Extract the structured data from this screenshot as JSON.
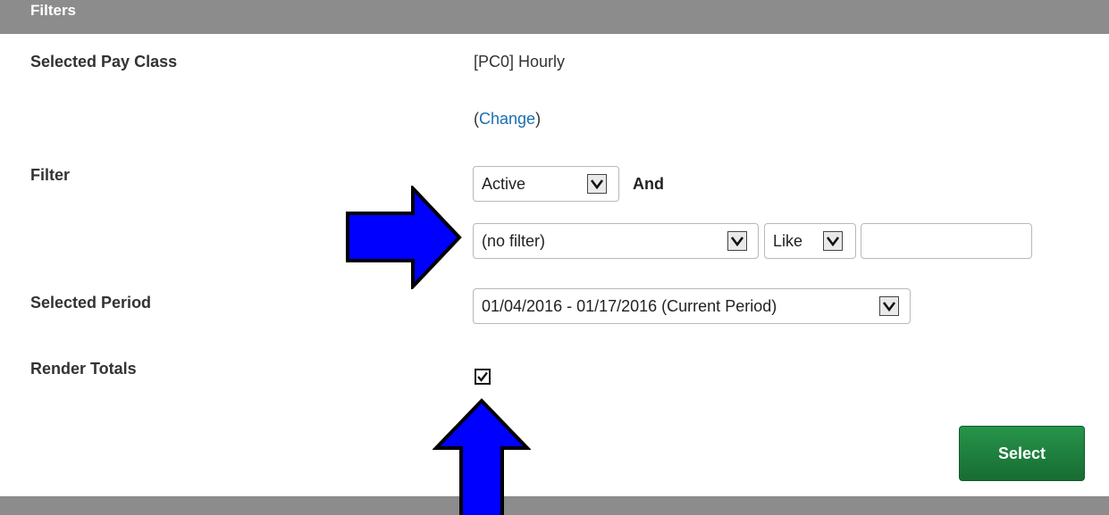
{
  "header": {
    "title": "Filters"
  },
  "pay_class": {
    "label": "Selected Pay Class",
    "value": "[PC0] Hourly",
    "change_open": "(",
    "change_link": "Change",
    "change_close": ")"
  },
  "filter": {
    "label": "Filter",
    "status_select": "Active",
    "and_label": "And",
    "field_select": "(no filter)",
    "operator_select": "Like",
    "value_input": ""
  },
  "period": {
    "label": "Selected Period",
    "select_value": "01/04/2016 - 01/17/2016 (Current Period)"
  },
  "render_totals": {
    "label": "Render Totals",
    "checked": true
  },
  "actions": {
    "select_label": "Select"
  },
  "annotations": {
    "arrow_color": "#0000ff",
    "arrows": [
      "right-pointing arrow at filter field dropdown",
      "up-pointing arrow at render totals checkbox"
    ]
  },
  "colors": {
    "bar": "#8c8c8c",
    "link": "#1a6fb0",
    "select_button": "#1f7f3e"
  }
}
